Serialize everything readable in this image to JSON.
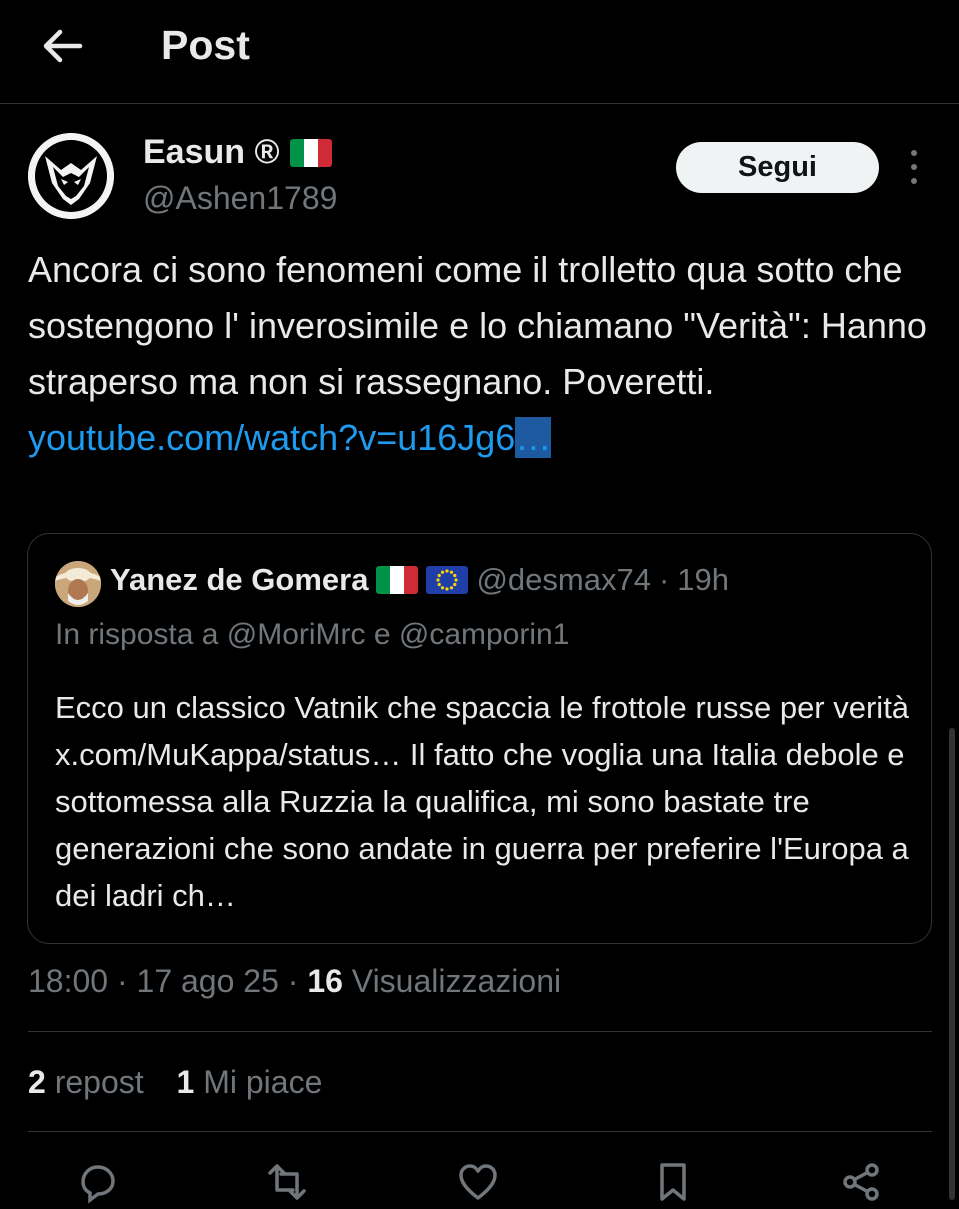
{
  "header": {
    "title": "Post"
  },
  "post": {
    "author_name": "Easun ®",
    "author_handle": "@Ashen1789",
    "follow_label": "Segui",
    "text": "Ancora ci sono fenomeni come il trolletto qua sotto che sostengono l' inverosimile e lo chiamano \"Verità\": Hanno straperso ma non si rassegnano. Poveretti. ",
    "link_text": "youtube.com/watch?v=u16Jg6",
    "link_tail": "…",
    "time": "18:00",
    "date": "17 ago 25",
    "views_count": "16",
    "views_label": "Visualizzazioni",
    "reposts_count": "2",
    "reposts_label": "repost",
    "likes_count": "1",
    "likes_label": "Mi piace"
  },
  "quote": {
    "author_name": "Yanez de Gomera",
    "author_handle": "@desmax74",
    "age": "19h",
    "reply_to": "In risposta a @MoriMrc e @camporin1",
    "text": "Ecco un classico Vatnik  che spaccia le frottole russe per verità x.com/MuKappa/status… Il fatto che voglia una Italia debole e sottomessa alla Ruzzia la qualifica, mi sono bastate tre generazioni che sono andate in guerra per preferire l'Europa a dei ladri ch…"
  },
  "flags": {
    "italy": [
      "#009246",
      "#ffffff",
      "#ce2b37"
    ],
    "eu": "#1f3ea8"
  },
  "colors": {
    "background": "#000000",
    "text": "#e7e9ea",
    "muted": "#71767b",
    "link": "#1d9bf0",
    "border": "#2f3336"
  },
  "icons": [
    "back-arrow-icon",
    "more-icon",
    "reply-icon",
    "repost-icon",
    "like-icon",
    "bookmark-icon",
    "share-icon"
  ]
}
